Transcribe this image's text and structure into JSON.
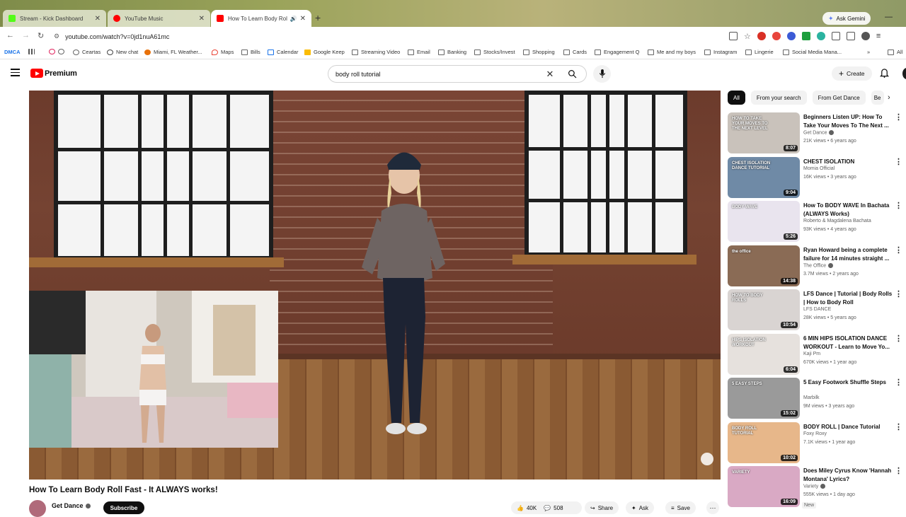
{
  "browser": {
    "tabs": [
      {
        "title": "Stream - Kick Dashboard",
        "favicon_color": "#53fc18"
      },
      {
        "title": "YouTube Music",
        "favicon_color": "#ff0000"
      },
      {
        "title": "How To Learn Body Roll Fas",
        "favicon_color": "#ff0000"
      }
    ],
    "ask_gemini": "Ask Gemini",
    "url": "youtube.com/watch?v=0jd1nuA61mc",
    "bookmarks": [
      "DMCA",
      "Ceartas",
      "New chat",
      "Miami, FL Weather...",
      "Maps",
      "Bills",
      "Calendar",
      "Google Keep",
      "Streaming Video",
      "Email",
      "Banking",
      "Stocks/Invest",
      "Shopping",
      "Cards",
      "Engagement Q",
      "Me and my boys",
      "Instagram",
      "Lingerie",
      "Social Media Mana...",
      "All"
    ]
  },
  "youtube": {
    "logo_text": "Premium",
    "search_query": "body roll tutorial",
    "create_label": "Create"
  },
  "video": {
    "title": "How To Learn Body Roll Fast - It ALWAYS works!",
    "channel": "Get Dance",
    "subscribe_label": "Subscribe",
    "likes": "40K",
    "comments": "508",
    "share_label": "Share",
    "ask_label": "Ask",
    "save_label": "Save"
  },
  "chips": [
    "All",
    "From your search",
    "From Get Dance",
    "Be"
  ],
  "recommendations": [
    {
      "title": "Beginners Listen UP: How To Take Your Moves To The Next ...",
      "channel": "Get Dance",
      "verified": true,
      "views": "21K views",
      "age": "6 years ago",
      "duration": "8:07",
      "thumb": "#c9c2bb",
      "thumb_text": "HOW TO TAKE YOUR MOVES TO THE NEXT LEVEL",
      "new": false
    },
    {
      "title": "CHEST ISOLATION",
      "channel": "Momia Official",
      "verified": false,
      "views": "16K views",
      "age": "3 years ago",
      "duration": "9:04",
      "thumb": "#6f8aa6",
      "thumb_text": "CHEST ISOLATION DANCE TUTORIAL",
      "new": false
    },
    {
      "title": "How To BODY WAVE In Bachata (ALWAYS Works)",
      "channel": "Roberto & Magdalena Bachata",
      "verified": false,
      "views": "93K views",
      "age": "4 years ago",
      "duration": "5:26",
      "thumb": "#e9e4ee",
      "thumb_text": "BODY WAVE",
      "new": false
    },
    {
      "title": "Ryan Howard being a complete failure for 14 minutes straight ...",
      "channel": "The Office",
      "verified": true,
      "views": "3.7M views",
      "age": "2 years ago",
      "duration": "14:38",
      "thumb": "#8a6b55",
      "thumb_text": "the office",
      "new": false
    },
    {
      "title": "LFS Dance | Tutorial | Body Rolls | How to Body Roll",
      "channel": "LFS DANCE",
      "verified": false,
      "views": "28K views",
      "age": "5 years ago",
      "duration": "10:54",
      "thumb": "#d9d4d2",
      "thumb_text": "HOW TO BODY ROLLS",
      "new": false
    },
    {
      "title": "6 MIN HIPS ISOLATION DANCE WORKOUT - Learn to Move Yo...",
      "channel": "Kaji Pm",
      "verified": false,
      "views": "670K views",
      "age": "1 year ago",
      "duration": "6:04",
      "thumb": "#e6e1dd",
      "thumb_text": "HIPS ISOLATION WORKOUT",
      "new": false
    },
    {
      "title": "5 Easy Footwork Shuffle Steps",
      "channel": "Marbilk",
      "verified": false,
      "views": "9M views",
      "age": "3 years ago",
      "duration": "15:02",
      "thumb": "#9a9a9a",
      "thumb_text": "5 EASY STEPS",
      "new": false
    },
    {
      "title": "BODY ROLL | Dance Tutorial",
      "channel": "Foxy Roxy",
      "verified": false,
      "views": "7.1K views",
      "age": "1 year ago",
      "duration": "10:02",
      "thumb": "#e7b78a",
      "thumb_text": "BODY ROLL TUTORIAL",
      "new": false
    },
    {
      "title": "Does Miley Cyrus Know 'Hannah Montana' Lyrics?",
      "channel": "Variety",
      "verified": true,
      "views": "555K views",
      "age": "1 day ago",
      "duration": "16:09",
      "thumb": "#d9a9c4",
      "thumb_text": "VARIETY",
      "new": true
    }
  ],
  "new_badge": "New"
}
